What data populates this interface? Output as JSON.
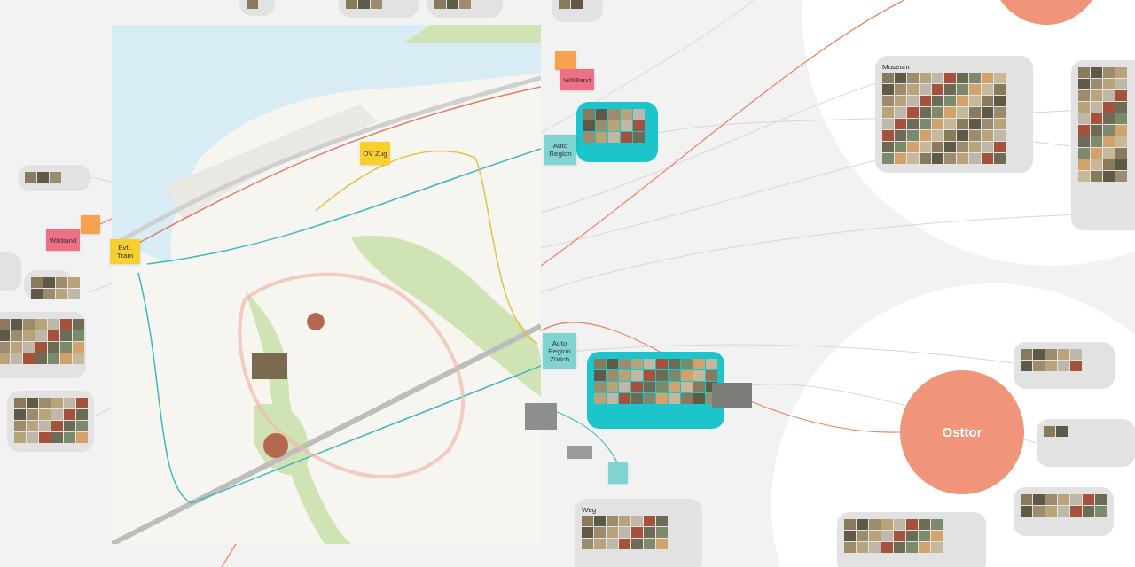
{
  "topics": [
    {
      "label": "Osttor"
    }
  ],
  "cards": [
    {
      "kind": "gray"
    },
    {
      "kind": "gray"
    },
    {
      "kind": "gray"
    },
    {
      "kind": "gray"
    },
    {
      "kind": "gray"
    },
    {
      "kind": "gray"
    },
    {
      "kind": "gray"
    },
    {
      "kind": "gray"
    },
    {
      "kind": "gray"
    },
    {
      "kind": "gray",
      "title": "Museum"
    },
    {
      "kind": "gray"
    },
    {
      "kind": "gray"
    },
    {
      "kind": "gray"
    },
    {
      "kind": "gray"
    },
    {
      "kind": "gray"
    },
    {
      "kind": "gray",
      "title": "Weg"
    },
    {
      "kind": "teal"
    },
    {
      "kind": "teal"
    }
  ],
  "stickies": [
    {
      "color": "#f7a24e"
    },
    {
      "color": "#ef6f86",
      "text": "Wildland"
    },
    {
      "color": "#f7a24e"
    },
    {
      "color": "#ef6f86",
      "text": "Wildland"
    },
    {
      "color": "#7fd3d0",
      "text": "Auto Region"
    },
    {
      "color": "#7fd3d0",
      "text": "Auto Region Zürich"
    },
    {
      "color": "#7fd3d0"
    },
    {
      "color": "#f7cf2f",
      "text": "Evtl. Tram"
    },
    {
      "color": "#f7cf2f",
      "text": "ÖV Zug"
    }
  ]
}
